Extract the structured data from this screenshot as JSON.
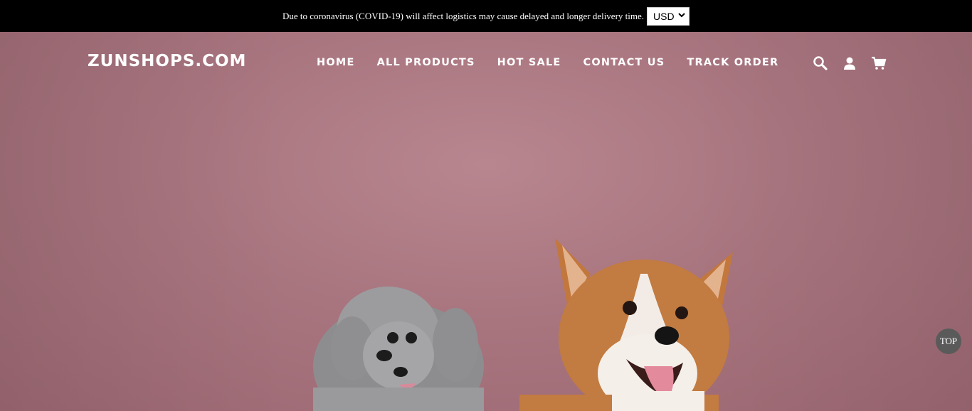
{
  "announcement": {
    "message": "Due to coronavirus (COVID-19) will affect logistics may cause delayed and longer delivery time.",
    "currency_selected": "USD"
  },
  "header": {
    "logo": "ZUNSHOPS.COM",
    "nav": [
      {
        "label": "HOME"
      },
      {
        "label": "ALL PRODUCTS"
      },
      {
        "label": "HOT SALE"
      },
      {
        "label": "CONTACT US"
      },
      {
        "label": "TRACK ORDER"
      }
    ],
    "icons": [
      "search-icon",
      "account-icon",
      "cart-icon"
    ]
  },
  "hero": {
    "image": "poodle-and-corgi-on-pink-background",
    "background_color": "#a8757f"
  },
  "back_to_top": {
    "label": "TOP"
  }
}
